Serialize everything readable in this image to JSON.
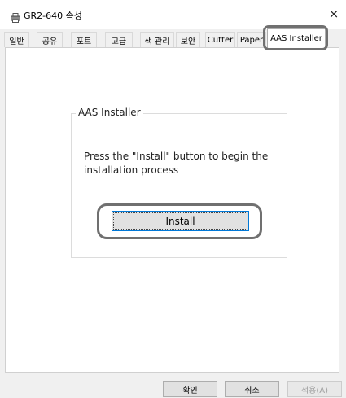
{
  "window": {
    "title": "GR2-640 속성",
    "close_glyph": "×",
    "icon": "printer-icon"
  },
  "tabs": [
    {
      "label": "일반"
    },
    {
      "label": "공유"
    },
    {
      "label": "포트"
    },
    {
      "label": "고급"
    },
    {
      "label": "색 관리"
    },
    {
      "label": "보안"
    },
    {
      "label": "Cutter"
    },
    {
      "label": "Paper"
    },
    {
      "label": "AAS Installer",
      "active": true
    }
  ],
  "group": {
    "title": "AAS Installer",
    "description": "Press the \"Install\" button to begin the installation process",
    "install_label": "Install"
  },
  "footer": {
    "ok_label": "확인",
    "cancel_label": "취소",
    "apply_label": "적용(A)"
  },
  "colors": {
    "focus": "#0078d7",
    "highlight_outline": "#707070"
  }
}
